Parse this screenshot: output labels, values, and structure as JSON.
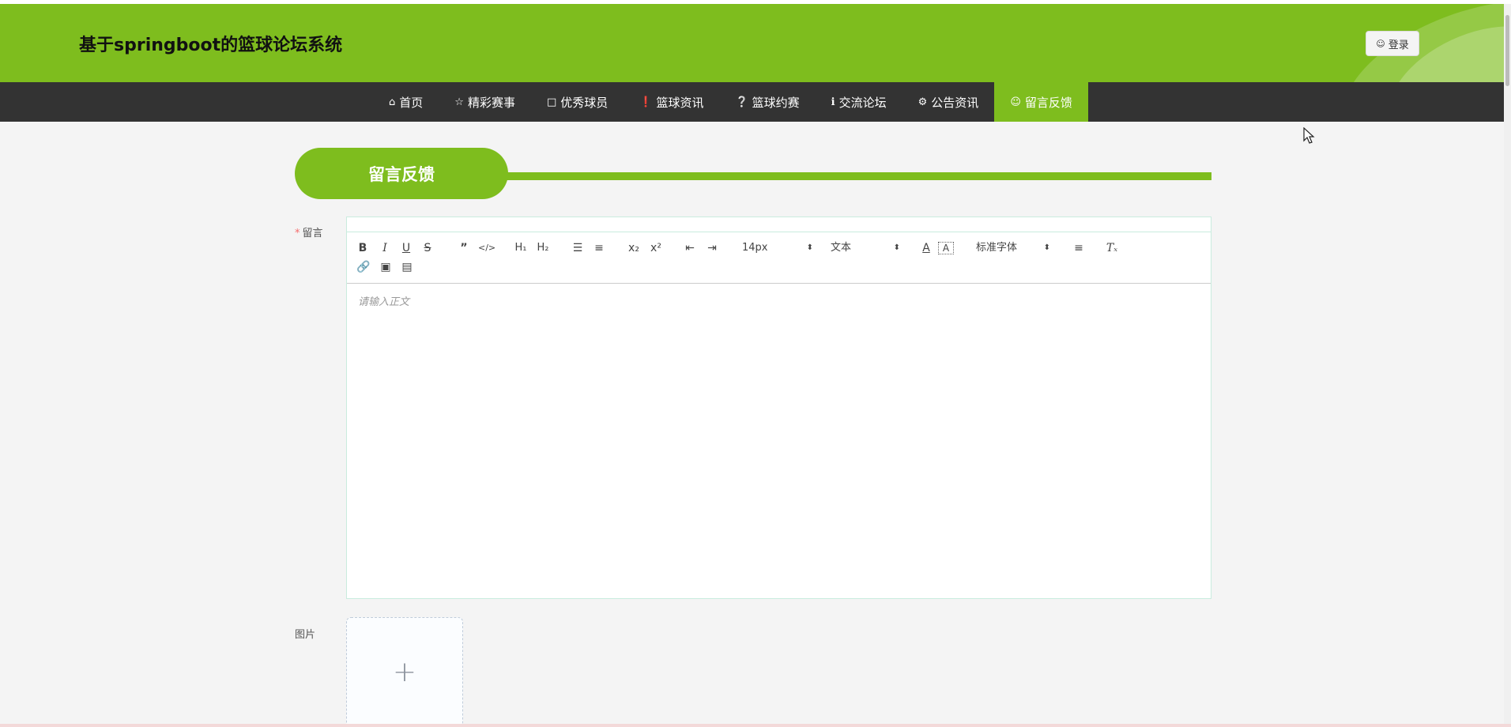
{
  "header": {
    "site_title": "基于springboot的篮球论坛系统",
    "login_label": "登录",
    "login_icon": "user-icon",
    "accent_color": "#7ebd1e"
  },
  "nav": {
    "items": [
      {
        "label": "首页",
        "icon": "home-icon"
      },
      {
        "label": "精彩赛事",
        "icon": "star-icon"
      },
      {
        "label": "优秀球员",
        "icon": "bag-icon"
      },
      {
        "label": "篮球资讯",
        "icon": "warning-icon"
      },
      {
        "label": "篮球约赛",
        "icon": "question-icon"
      },
      {
        "label": "交流论坛",
        "icon": "info-icon"
      },
      {
        "label": "公告资讯",
        "icon": "settings-icon"
      },
      {
        "label": "留言反馈",
        "icon": "smile-icon"
      }
    ],
    "active_index": 7
  },
  "section": {
    "title": "留言反馈"
  },
  "form": {
    "message_label": "留言",
    "message_required_mark": "*",
    "image_label": "图片",
    "editor": {
      "placeholder": "请输入正文",
      "font_size": "14px",
      "header_select": "文本",
      "font_family": "标准字体",
      "tools": [
        "bold",
        "italic",
        "underline",
        "strike",
        "blockquote",
        "code-block",
        "header-1",
        "header-2",
        "ordered-list",
        "bullet-list",
        "subscript",
        "superscript",
        "indent-decrease",
        "indent-increase",
        "font-color",
        "background-color",
        "align",
        "clean",
        "link",
        "image",
        "video"
      ]
    },
    "upload_plus": "+"
  }
}
